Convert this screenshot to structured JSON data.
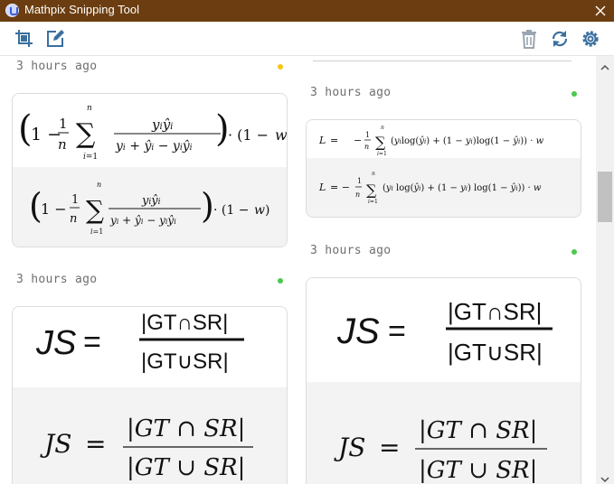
{
  "window": {
    "title": "Mathpix Snipping Tool"
  },
  "toolbar": {
    "left_icons": [
      "screenshot-crop-icon",
      "edit-icon"
    ],
    "right_icons": [
      "trash-icon",
      "sync-icon",
      "settings-icon"
    ]
  },
  "colors": {
    "titlebar": "#6b3d10",
    "dot_yellow": "#f5c518",
    "dot_green": "#4cc94c"
  },
  "history": [
    {
      "timestamp": "3 hours ago",
      "status": "yellow",
      "snip_math": "(1 − (1/n) Σ_{i=1}^{n} y_i ŷ_i / (y_i + ŷ_i − y_i ŷ_i)) · (1 − w)",
      "rendered_math": "(1 − (1/n) Σ_{i=1}^{n} y_i ŷ_i / (y_i + ŷ_i − y_i ŷ_i)) · (1 − w)"
    },
    {
      "timestamp": "3 hours ago",
      "status": "green",
      "snip_math": "L = − (1/n) Σ_{i=1}^{n} (y_i log(ŷ_i) + (1 − y_i) log(1 − ŷ_i)) · w",
      "rendered_math": "L = − (1/n) Σ_{i=1}^{n} (y_i log(ŷ_i) + (1 − y_i) log(1 − ŷ_i)) · w"
    },
    {
      "timestamp": "3 hours ago",
      "status": "green",
      "snip_math": "JS = |GT∩SR| / |GT∪SR|",
      "rendered_math": "JS = |GT ∩ SR| / |GT ∪ SR|"
    },
    {
      "timestamp": "3 hours ago",
      "status": "green",
      "snip_math": "JS = |GT∩SR| / |GT∪SR|",
      "rendered_math": "JS = |GT ∩ SR| / |GT ∪ SR|"
    }
  ]
}
